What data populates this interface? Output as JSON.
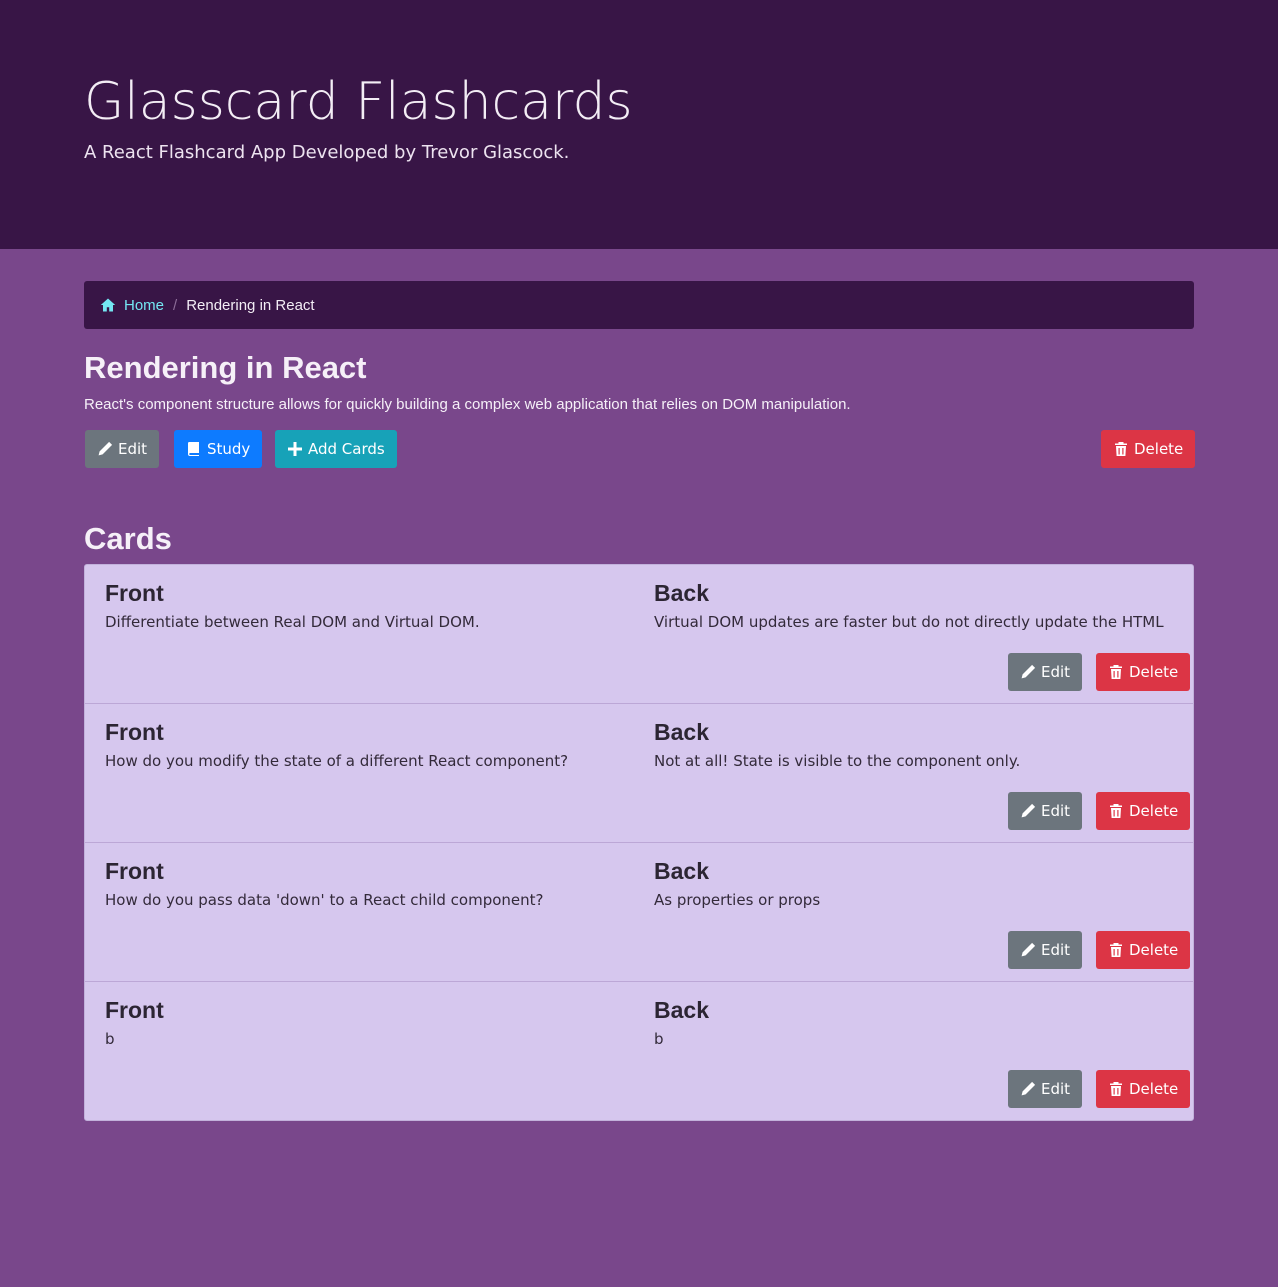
{
  "header": {
    "title": "Glasscard Flashcards",
    "subtitle": "A React Flashcard App Developed by Trevor Glascock."
  },
  "breadcrumb": {
    "home": "Home",
    "separator": "/",
    "current": "Rendering in React"
  },
  "deck": {
    "title": "Rendering in React",
    "description": "React's component structure allows for quickly building a complex web application that relies on DOM manipulation.",
    "edit_label": "Edit",
    "study_label": "Study",
    "add_cards_label": "Add Cards",
    "delete_label": "Delete"
  },
  "cards_section": {
    "title": "Cards",
    "front_heading": "Front",
    "back_heading": "Back",
    "edit_label": "Edit",
    "delete_label": "Delete",
    "cards": [
      {
        "front": "Differentiate between Real DOM and Virtual DOM.",
        "back": "Virtual DOM updates are faster but do not directly update the HTML"
      },
      {
        "front": "How do you modify the state of a different React component?",
        "back": "Not at all! State is visible to the component only."
      },
      {
        "front": "How do you pass data 'down' to a React child component?",
        "back": "As properties or props"
      },
      {
        "front": "b",
        "back": "b"
      }
    ]
  },
  "colors": {
    "header_bg": "#381546",
    "page_bg": "#79478b",
    "card_bg": "#d6c7ee",
    "link": "#74e6f2"
  },
  "icons": {
    "home": "home-icon",
    "edit": "pencil-icon",
    "study": "book-icon",
    "add": "plus-icon",
    "delete": "trash-icon"
  }
}
